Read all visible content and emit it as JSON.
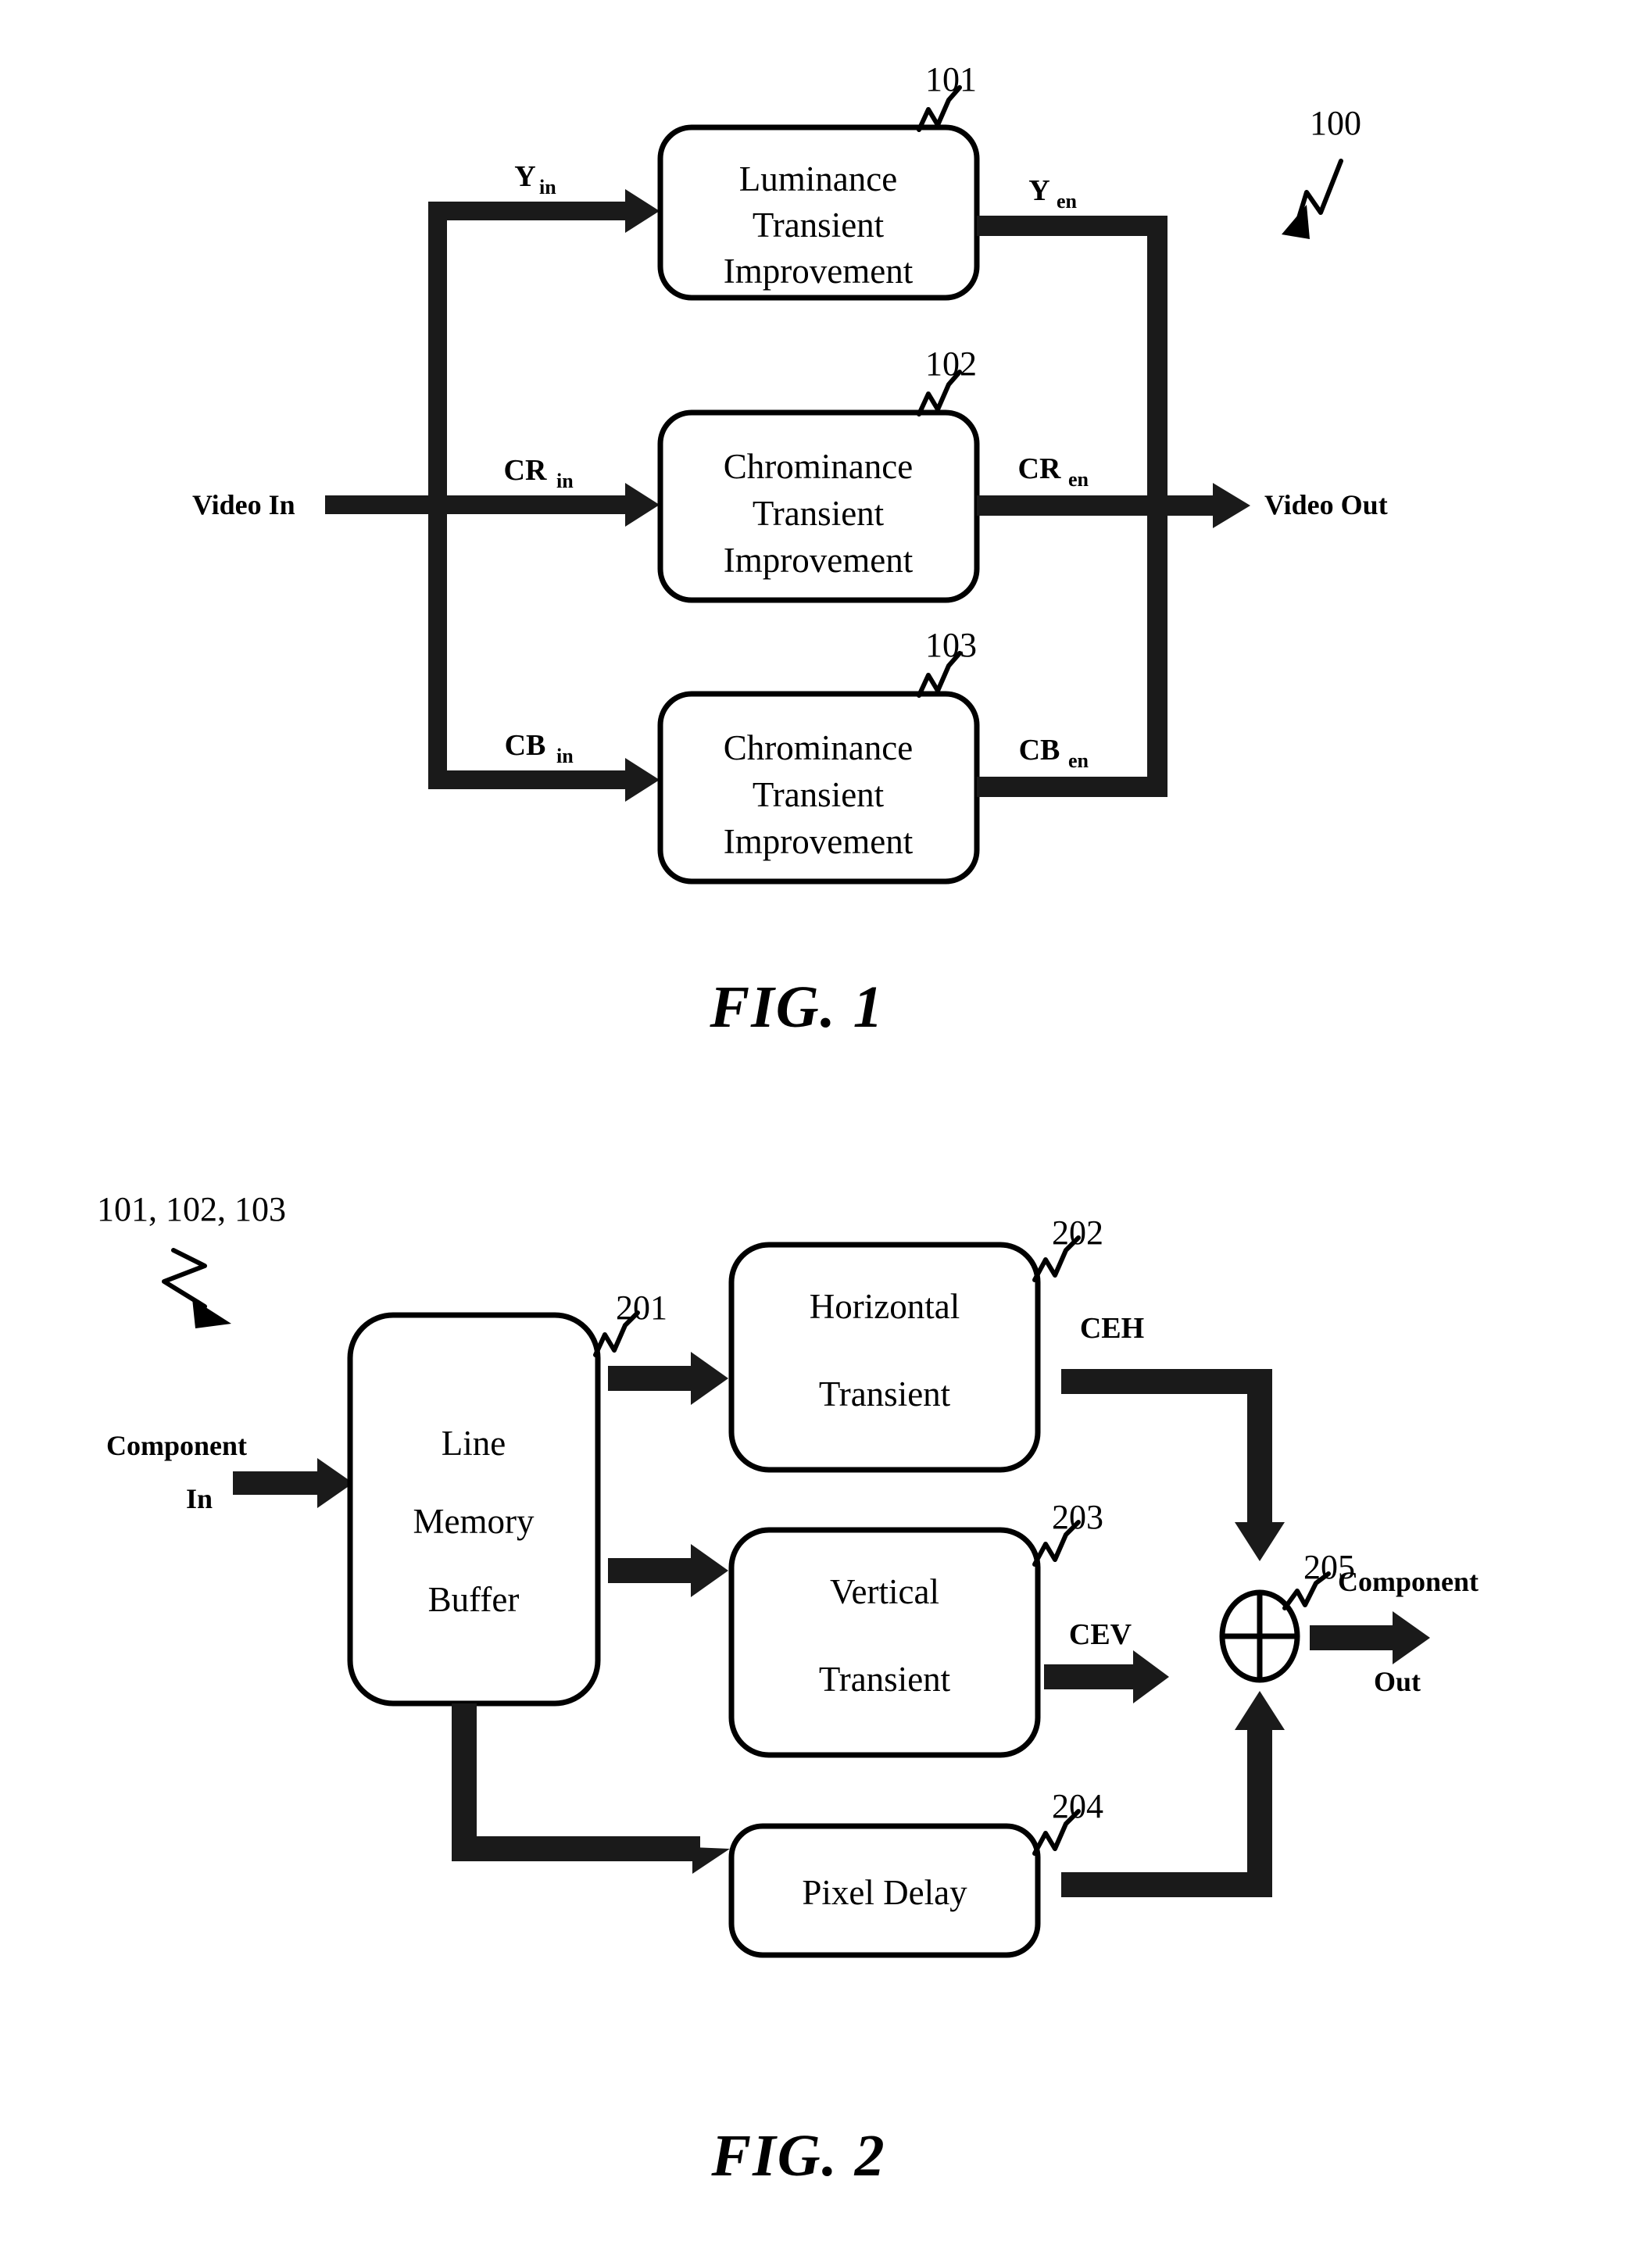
{
  "document": {
    "type": "patent-drawing-sheet",
    "background_color": "#ffffff",
    "ink_color": "#000000"
  },
  "figure1": {
    "caption": "FIG.  1",
    "system_ref": "100",
    "input_port_label": "Video In",
    "output_port_label": "Video Out",
    "blocks": [
      {
        "ref": "101",
        "lines": [
          "Luminance",
          "Transient",
          "Improvement"
        ],
        "input_signal": "Y",
        "input_signal_sub": "in",
        "output_signal": "Y",
        "output_signal_sub": "en"
      },
      {
        "ref": "102",
        "lines": [
          "Chrominance",
          "Transient",
          "Improvement"
        ],
        "input_signal": "CR",
        "input_signal_sub": "in",
        "output_signal": "CR",
        "output_signal_sub": "en"
      },
      {
        "ref": "103",
        "lines": [
          "Chrominance",
          "Transient",
          "Improvement"
        ],
        "input_signal": "CB",
        "input_signal_sub": "in",
        "output_signal": "CB",
        "output_signal_sub": "en"
      }
    ]
  },
  "figure2": {
    "caption": "FIG.  2",
    "group_ref": "101, 102, 103",
    "input_port_line1": "Component",
    "input_port_line2": "In",
    "output_port_line1": "Component",
    "output_port_line2": "Out",
    "blocks": [
      {
        "ref": "201",
        "lines": [
          "Line",
          "Memory",
          "Buffer"
        ]
      },
      {
        "ref": "202",
        "lines": [
          "Horizontal",
          "Transient"
        ]
      },
      {
        "ref": "203",
        "lines": [
          "Vertical",
          "Transient"
        ]
      },
      {
        "ref": "204",
        "lines": [
          "Pixel Delay"
        ]
      }
    ],
    "adder": {
      "ref": "205",
      "glyph": "plus-in-circle"
    },
    "signals": [
      {
        "name": "CEH",
        "from": "202",
        "to": "205"
      },
      {
        "name": "CEV",
        "from": "203",
        "to": "205"
      }
    ]
  }
}
